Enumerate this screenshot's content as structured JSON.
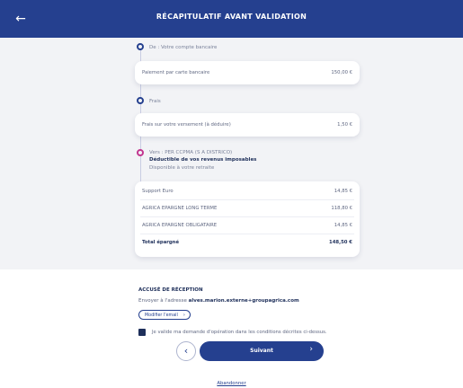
{
  "header": {
    "title": "RÉCAPITULATIF AVANT VALIDATION",
    "back_icon": "←"
  },
  "steps": {
    "from": {
      "label": "De : Votre compte bancaire"
    },
    "payment": {
      "label": "Paiement par carte bancaire",
      "amount": "150,00 €"
    },
    "fees": {
      "label": "Frais"
    },
    "fees_row": {
      "label": "Frais sur votre versement (à déduire)",
      "amount": "1,50 €"
    },
    "to": {
      "label": "Vers : PER CCPMA (S A DISTRICO)",
      "deductible": "Déductible de vos revenus imposables",
      "available": "Disponible à votre retraite"
    },
    "allocation": [
      {
        "label": "Support Euro",
        "amount": "14,85 €"
      },
      {
        "label": "AGRICA EPARGNE LONG TERME",
        "amount": "118,80 €"
      },
      {
        "label": "AGRICA EPARGNE OBLIGATAIRE",
        "amount": "14,85 €"
      }
    ],
    "total": {
      "label": "Total épargné",
      "amount": "148,50 €"
    }
  },
  "ack": {
    "title": "ACCUSÉ DE RÉCEPTION",
    "text_prefix": "Envoyer à l'adresse",
    "email": "alves.marion.externe+groupagrica.com",
    "modify_label": "Modifier l'email",
    "chevron": "›"
  },
  "confirm": {
    "text": "Je valide ma demande d'opération dans les conditions décrites ci-dessus."
  },
  "nav": {
    "prev_icon": "‹",
    "next_label": "Suivant",
    "next_icon": "›",
    "abandon_label": "Abandonner"
  },
  "colors": {
    "primary": "#25408f",
    "accent": "#c2368f",
    "background": "#f2f3f6"
  }
}
